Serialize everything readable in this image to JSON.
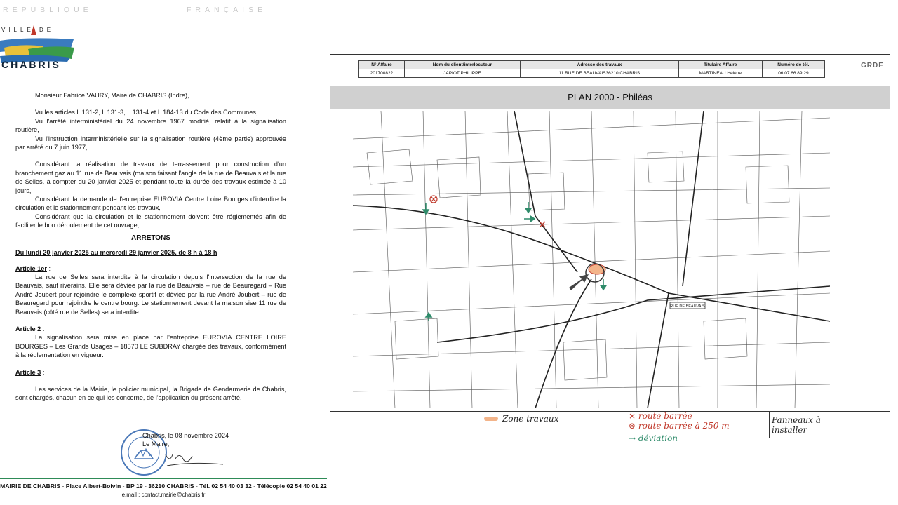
{
  "header": {
    "republique": "REPUBLIQUE",
    "francaise": "FRANÇAISE",
    "logo_ville": "VILLE DE",
    "logo_name": "CHABRIS"
  },
  "document": {
    "mayor": "Monsieur Fabrice VAURY, Maire de CHABRIS (Indre),",
    "vu1": "Vu les articles L 131-2, L 131-3, L 131-4 et L 184-13 du Code des Communes,",
    "vu2": "Vu l'arrêté interministériel du 24 novembre 1967 modifié, relatif à la signalisation routière,",
    "vu3": "Vu l'instruction interministérielle sur la signalisation routière (4ème partie) approuvée par arrêté du 7 juin 1977,",
    "cons1": "Considérant la réalisation de travaux de terrassement pour construction d'un branchement gaz au 11 rue de Beauvais (maison faisant l'angle de la rue de Beauvais et la rue de Selles, à compter du 20 janvier 2025 et pendant toute la durée des travaux estimée à 10 jours,",
    "cons2": "Considérant la demande de l'entreprise EUROVIA Centre Loire Bourges d'interdire la circulation et le stationnement pendant les travaux,",
    "cons3": "Considérant que la circulation et le stationnement doivent être réglementés afin de faciliter le bon déroulement de cet ouvrage,",
    "arretons": "ARRETONS",
    "period": "Du lundi 20 janvier 2025 au mercredi 29 janvier 2025, de 8 h à 18 h",
    "art1_title": "Article 1er",
    "art1_text": "La rue de Selles sera interdite à la circulation depuis l'intersection de la rue de Beauvais, sauf riverains. Elle sera déviée par la rue de Beauvais – rue de Beauregard – Rue André Joubert pour rejoindre le complexe sportif et déviée par la rue André Joubert – rue de Beauregard pour rejoindre le centre bourg. Le stationnement devant la maison sise 11 rue de Beauvais (côté rue de Selles) sera interdite.",
    "art2_title": "Article 2",
    "art2_text": "La signalisation sera mise en place par l'entreprise EUROVIA CENTRE LOIRE BOURGES – Les Grands Usages – 18570 LE SUBDRAY chargée des travaux, conformément à la réglementation en vigueur.",
    "art3_title": "Article 3",
    "art3_text": "Les services de la Mairie, le policier municipal, la Brigade de Gendarmerie de Chabris, sont chargés, chacun en ce qui les concerne, de l'application du présent arrêté.",
    "signoff_place_date": "Chabris, le 08 novembre 2024",
    "signoff_role": "Le Maire,",
    "signature": "Fabrice VAURY"
  },
  "footer": {
    "address": "MAIRIE DE CHABRIS - Place Albert-Boivin - BP 19 - 36210 CHABRIS - Tél. 02 54 40 03 32 - Télécopie 02 54 40 01 22",
    "email": "e.mail : contact.mairie@chabris.fr"
  },
  "plan": {
    "table_headers": [
      "N° Affaire",
      "Nom du client/interlocuteur",
      "Adresse des travaux",
      "Titulaire Affaire",
      "Numéro de tél."
    ],
    "table_row": [
      "201700822",
      "JAPIOT PHILIPPE",
      "11 RUE DE BEAUVAIS36210 CHABRIS",
      "MARTINEAU Hélène",
      "06 07 66 89 29"
    ],
    "grdf": "GRDF",
    "title": "PLAN 2000 - Philéas",
    "map_label": "RUE DE BEAUVAIS"
  },
  "legend": {
    "zone": "Zone travaux",
    "barree": "× route barrée",
    "barree250": "⊗ route barrée à 250 m",
    "deviation": "→ déviation",
    "panneaux": "Panneaux à installer"
  },
  "colors": {
    "work_zone": "#f3b48a",
    "barrier": "#c0392b",
    "deviation": "#2e8b6a",
    "footer_line": "#2e8b57"
  }
}
